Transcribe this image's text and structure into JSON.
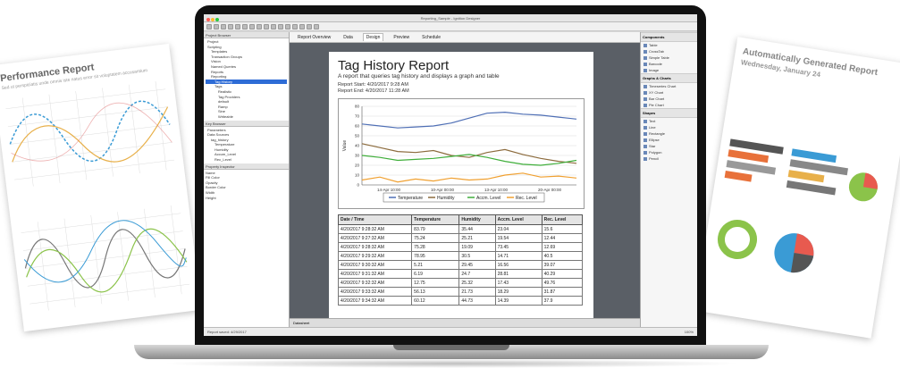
{
  "paper_left": {
    "title": "Performance Report",
    "subtitle": "Sed ut perspiciatis unde omnis iste natus error sit voluptatem accusantium"
  },
  "paper_right": {
    "title": "Automatically Generated Report",
    "subtitle": "Wednesday, January 24"
  },
  "app": {
    "window_title": "Reporting_Sample - Ignition Designer",
    "tabs": [
      "Report Overview",
      "Data",
      "Design",
      "Preview",
      "Schedule"
    ],
    "left_panel": {
      "header": "Project Browser",
      "tree": [
        "Project",
        "Scripting",
        "Templates",
        "Transaction Groups",
        "Vision",
        "Named Queries",
        "Reports",
        "Reporting",
        "Tag History",
        "Tags",
        "Realistic",
        "Tag Providers",
        "default",
        "Ramp",
        "Sine",
        "Writeable"
      ],
      "selected": "Tag History",
      "lower_header": "Key Browser",
      "lower_tree": [
        "Parameters",
        "Data Sources",
        "tag_history",
        "Temperature",
        "Humidity",
        "Accum_Level",
        "Rec_Level"
      ],
      "props_header": "Property Inspector",
      "props": [
        "Name",
        "Fill Color",
        "Opacity",
        "Border Color",
        "Width",
        "Height"
      ]
    },
    "right_panel": {
      "sections": [
        {
          "title": "Components",
          "items": [
            "Table",
            "CrossTab",
            "Simple Table",
            "Barcode",
            "Image"
          ]
        },
        {
          "title": "Graphs & Charts",
          "items": [
            "Timeseries Chart",
            "XY Chart",
            "Bar Chart",
            "Pie Chart"
          ]
        },
        {
          "title": "Shapes",
          "items": [
            "Text",
            "Line",
            "Rectangle",
            "Ellipse",
            "Star",
            "Polygon",
            "Pencil"
          ]
        }
      ]
    },
    "status_left": "Report saved: 4/29/2017",
    "status_right": "100%",
    "bottom_tab": "Datasheet"
  },
  "report": {
    "title": "Tag History Report",
    "subtitle": "A report that queries tag history and displays a graph and table",
    "start_label": "Report Start:",
    "start_value": "4/20/2017 9:28 AM",
    "end_label": "Report End:",
    "end_value": "4/20/2017 11:28 AM",
    "columns": [
      "Date / Time",
      "Temperature",
      "Humidity",
      "Accm. Level",
      "Rec. Level"
    ],
    "rows": [
      [
        "4/20/2017 9:28:32 AM",
        "83.79",
        "35.44",
        "23.04",
        "15.6"
      ],
      [
        "4/20/2017 9:27:32 AM",
        "75.24",
        "25.21",
        "19.54",
        "12.44"
      ],
      [
        "4/20/2017 9:28:32 AM",
        "75.28",
        "19.09",
        "73.45",
        "12.69"
      ],
      [
        "4/20/2017 9:29:32 AM",
        "78.95",
        "30.5",
        "14.71",
        "40.5"
      ],
      [
        "4/20/2017 9:30:32 AM",
        "5.21",
        "29.45",
        "16.56",
        "39.07"
      ],
      [
        "4/20/2017 9:31:32 AM",
        "6.19",
        "24.7",
        "28.81",
        "40.29"
      ],
      [
        "4/20/2017 9:32:32 AM",
        "12.75",
        "25.32",
        "17.43",
        "49.76"
      ],
      [
        "4/20/2017 9:33:32 AM",
        "56.13",
        "21.73",
        "18.29",
        "31.87"
      ],
      [
        "4/20/2017 9:34:32 AM",
        "60.12",
        "44.73",
        "14.39",
        "37.9"
      ]
    ]
  },
  "chart_data": {
    "type": "line",
    "ylabel": "Value",
    "ylim": [
      0,
      80
    ],
    "yticks": [
      0,
      10,
      20,
      30,
      40,
      50,
      60,
      70,
      80
    ],
    "xticks": [
      "14-Apr 10:00",
      "10-Apr 00:00",
      "13-Apr 10:00",
      "20-Apr 00:00"
    ],
    "x": [
      0,
      1,
      2,
      3,
      4,
      5,
      6,
      7,
      8,
      9,
      10,
      11,
      12
    ],
    "series": [
      {
        "name": "Temperature",
        "color": "#4f6fb5",
        "values": [
          62,
          60,
          58,
          59,
          60,
          63,
          68,
          73,
          74,
          72,
          71,
          69,
          67
        ]
      },
      {
        "name": "Humidity",
        "color": "#8c6b3d",
        "values": [
          42,
          38,
          34,
          33,
          35,
          30,
          28,
          33,
          36,
          31,
          27,
          24,
          22
        ]
      },
      {
        "name": "Accm. Level",
        "color": "#3fae3a",
        "values": [
          30,
          28,
          25,
          26,
          27,
          29,
          31,
          28,
          24,
          21,
          20,
          22,
          25
        ]
      },
      {
        "name": "Rec. Level",
        "color": "#f0a030",
        "values": [
          5,
          8,
          3,
          6,
          4,
          7,
          5,
          6,
          10,
          12,
          8,
          9,
          7
        ]
      }
    ],
    "legend": "bottom"
  },
  "colors": {
    "laptop": "#111111",
    "canvas_bg": "#5a5f66",
    "selection": "#2e6cd6"
  }
}
